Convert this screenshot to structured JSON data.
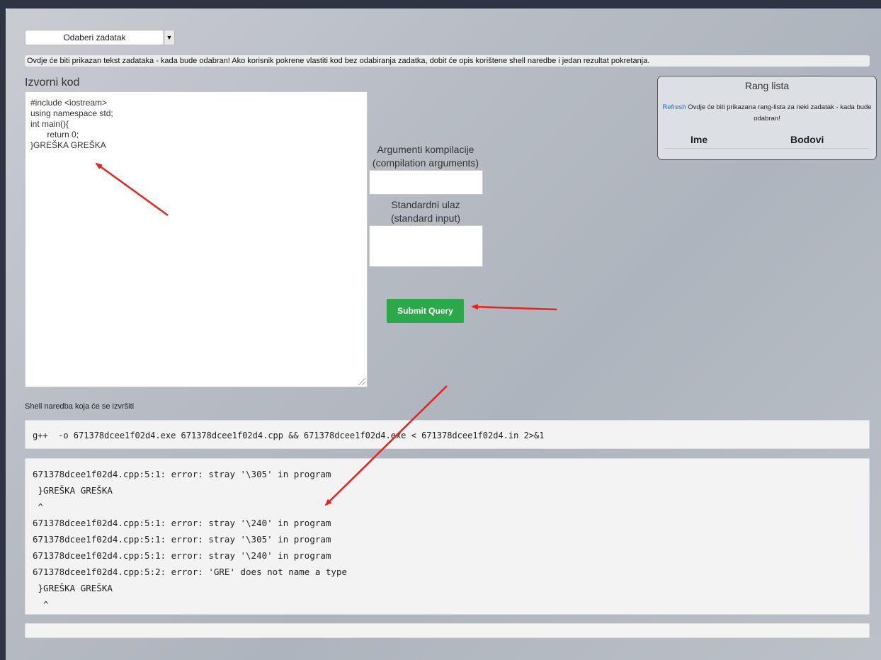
{
  "task_select": {
    "selected": "Odaberi zadatak",
    "arrow": "▼"
  },
  "task_description": "Ovdje će biti prikazan tekst zadataka - kada bude odabran! Ako korisnik pokrene vlastiti kod bez odabiranja zadatka, dobit će opis korištene shell naredbe i jedan rezultat pokretanja.",
  "source": {
    "title": "Izvorni kod",
    "lines": [
      "#include <iostream>",
      "using namespace std;",
      "int main(){",
      "       return 0;",
      "}GREŠKA GREŠKA"
    ]
  },
  "compile_args": {
    "label_line1": "Argumenti kompilacije",
    "label_line2": "(compilation arguments)",
    "value": ""
  },
  "stdin": {
    "label_line1": "Standardni ulaz",
    "label_line2": "(standard input)",
    "value": ""
  },
  "submit_label": "Submit Query",
  "rank": {
    "title": "Rang lista",
    "refresh_label": "Refresh",
    "message": " Ovdje će biti prikazana rang-lista za neki zadatak - kada bude odabran!",
    "col_name": "Ime",
    "col_points": "Bodovi"
  },
  "shell": {
    "label": "Shell naredba koja će se izvršiti",
    "command": "g++  -o 671378dcee1f02d4.exe 671378dcee1f02d4.cpp && 671378dcee1f02d4.exe < 671378dcee1f02d4.in 2>&1"
  },
  "output_lines": [
    "671378dcee1f02d4.cpp:5:1: error: stray '\\305' in program",
    " }GREŠKA GREŠKA",
    " ^",
    "671378dcee1f02d4.cpp:5:1: error: stray '\\240' in program",
    "671378dcee1f02d4.cpp:5:1: error: stray '\\305' in program",
    "671378dcee1f02d4.cpp:5:1: error: stray '\\240' in program",
    "671378dcee1f02d4.cpp:5:2: error: 'GRE' does not name a type",
    " }GREŠKA GREŠKA",
    "  ^"
  ],
  "colors": {
    "submit_bg": "#2aa84a",
    "annotation_arrow": "#e8231c",
    "refresh_link": "#1a6fd1"
  }
}
